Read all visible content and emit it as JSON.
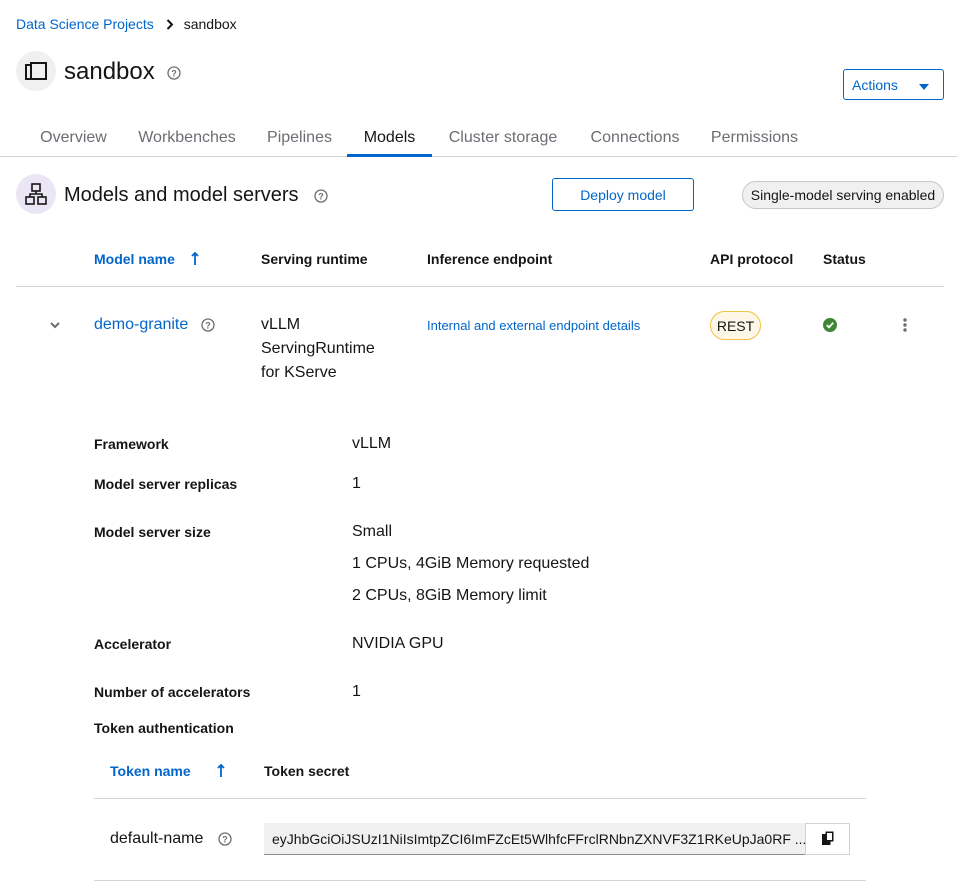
{
  "breadcrumb": {
    "parent": "Data Science Projects",
    "current": "sandbox"
  },
  "project": {
    "title": "sandbox"
  },
  "actions": {
    "label": "Actions"
  },
  "tabs": [
    {
      "label": "Overview",
      "active": false
    },
    {
      "label": "Workbenches",
      "active": false
    },
    {
      "label": "Pipelines",
      "active": false
    },
    {
      "label": "Models",
      "active": true
    },
    {
      "label": "Cluster storage",
      "active": false
    },
    {
      "label": "Connections",
      "active": false
    },
    {
      "label": "Permissions",
      "active": false
    }
  ],
  "section": {
    "title": "Models and model servers",
    "deploy_label": "Deploy model",
    "serving_badge": "Single-model serving enabled"
  },
  "table": {
    "headers": {
      "model_name": "Model name",
      "serving_runtime": "Serving runtime",
      "inference_endpoint": "Inference endpoint",
      "api_protocol": "API protocol",
      "status": "Status"
    },
    "row": {
      "model_name": "demo-granite",
      "runtime_lines": [
        "vLLM",
        "ServingRuntime",
        "for KServe"
      ],
      "endpoint_link": "Internal and external endpoint details",
      "api_protocol": "REST",
      "status": "success"
    }
  },
  "details": {
    "framework": {
      "label": "Framework",
      "value": "vLLM"
    },
    "replicas": {
      "label": "Model server replicas",
      "value": "1"
    },
    "size": {
      "label": "Model server size",
      "values": [
        "Small",
        "1 CPUs, 4GiB Memory requested",
        "2 CPUs, 8GiB Memory limit"
      ]
    },
    "accelerator": {
      "label": "Accelerator",
      "value": "NVIDIA GPU"
    },
    "num_accelerators": {
      "label": "Number of accelerators",
      "value": "1"
    },
    "token_auth": {
      "label": "Token authentication"
    }
  },
  "tokens": {
    "headers": {
      "name": "Token name",
      "secret": "Token secret"
    },
    "rows": [
      {
        "name": "default-name",
        "secret": "eyJhbGciOiJSUzI1NiIsImtpZCI6ImFZcEt5WlhfcFFrclRNbnZXNVF3Z1RKeUpJa0RF ..."
      }
    ]
  },
  "colors": {
    "link": "#0066cc",
    "success": "#3e8635",
    "badge_purple": "#ebe6f5",
    "rest_border": "#f4c145"
  }
}
